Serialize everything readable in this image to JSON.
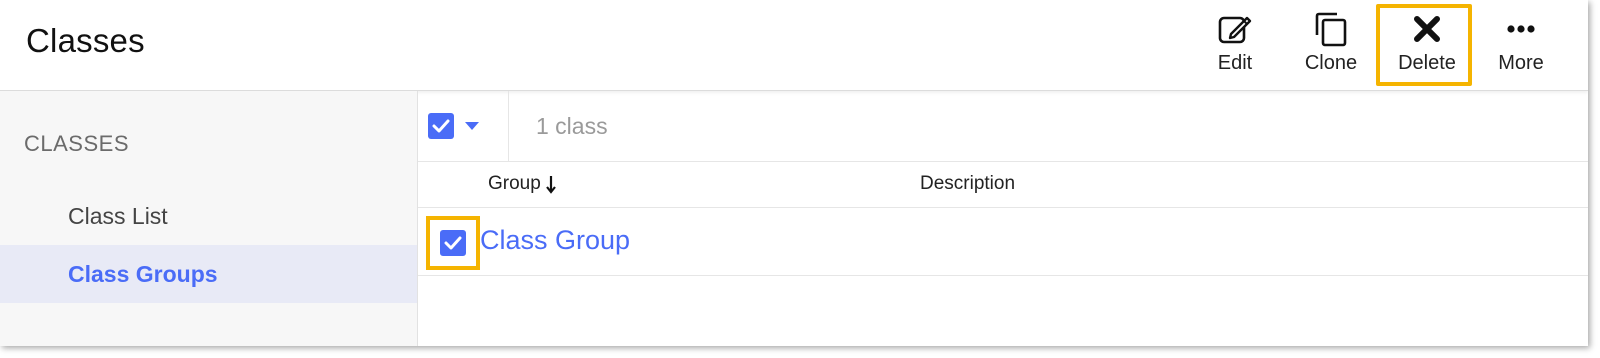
{
  "header": {
    "title": "Classes",
    "toolbar": {
      "edit_label": "Edit",
      "clone_label": "Clone",
      "delete_label": "Delete",
      "more_label": "More"
    }
  },
  "sidebar": {
    "heading": "CLASSES",
    "items": [
      {
        "label": "Class List",
        "active": false
      },
      {
        "label": "Class Groups",
        "active": true
      }
    ]
  },
  "main": {
    "count_text": "1 class",
    "columns": {
      "group": "Group",
      "description": "Description"
    },
    "rows": [
      {
        "group": "Class Group",
        "description": "",
        "selected": true
      }
    ]
  },
  "icons": {
    "edit": "edit-icon",
    "clone": "clone-icon",
    "delete": "delete-x-icon",
    "more": "more-dots-icon",
    "sort": "sort-down-arrow-icon",
    "dropdown": "caret-down-icon",
    "check": "check-icon"
  },
  "colors": {
    "accent": "#4a6cf7",
    "highlight": "#f5b400",
    "sidebar_active_bg": "#e8eaf6"
  }
}
